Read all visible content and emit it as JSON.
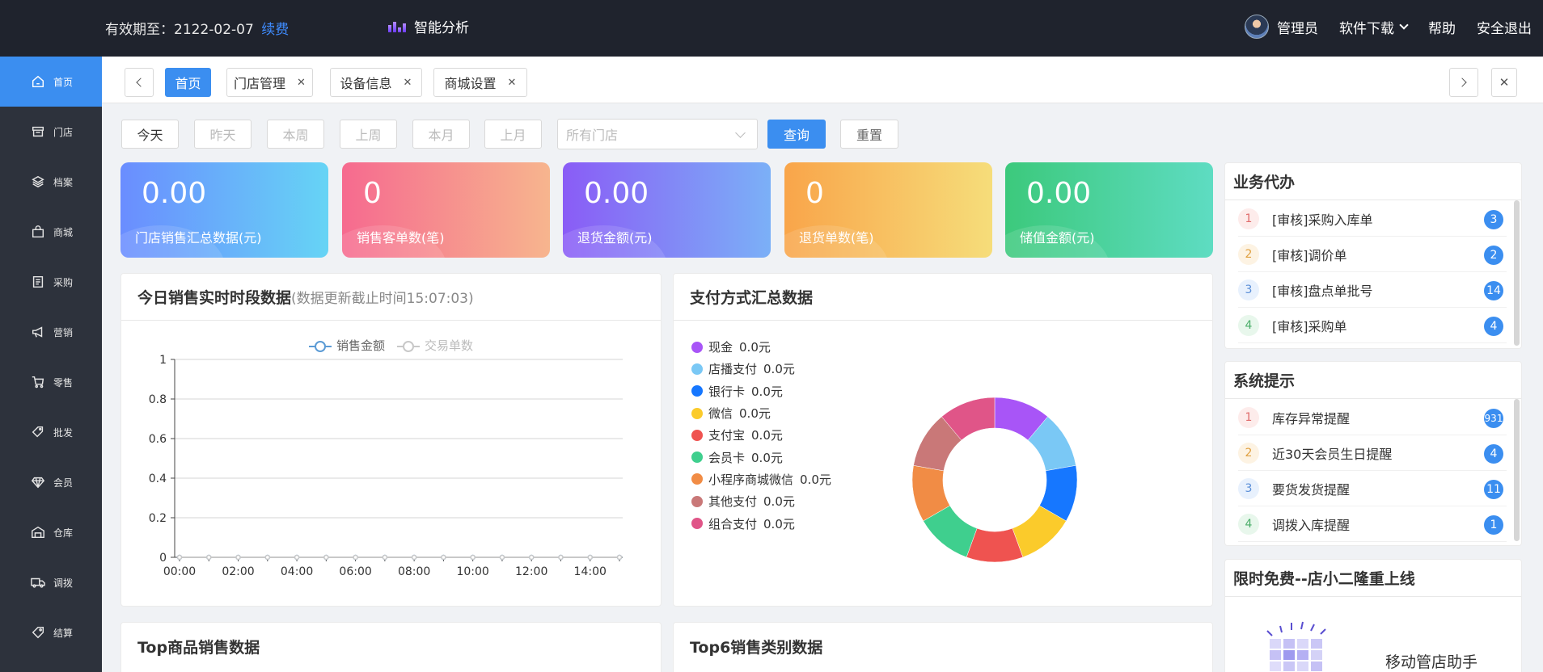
{
  "topbar": {
    "validity_label": "有效期至：2122-02-07",
    "renew": "续费",
    "brand": "智能分析",
    "user": "管理员",
    "download": "软件下载",
    "help": "帮助",
    "logout": "安全退出"
  },
  "sidebar": {
    "items": [
      {
        "label": "首页",
        "icon": "home-icon"
      },
      {
        "label": "门店",
        "icon": "store-icon"
      },
      {
        "label": "档案",
        "icon": "layers-icon"
      },
      {
        "label": "商城",
        "icon": "shopping-bag-icon"
      },
      {
        "label": "采购",
        "icon": "purchase-icon"
      },
      {
        "label": "营销",
        "icon": "megaphone-icon"
      },
      {
        "label": "零售",
        "icon": "cart-icon"
      },
      {
        "label": "批发",
        "icon": "wholesale-icon"
      },
      {
        "label": "会员",
        "icon": "diamond-icon"
      },
      {
        "label": "仓库",
        "icon": "warehouse-icon"
      },
      {
        "label": "调拨",
        "icon": "truck-icon"
      },
      {
        "label": "结算",
        "icon": "tag-icon"
      }
    ]
  },
  "tabs": [
    {
      "label": "首页"
    },
    {
      "label": "门店管理"
    },
    {
      "label": "设备信息"
    },
    {
      "label": "商城设置"
    }
  ],
  "filters": {
    "today": "今天",
    "yesterday": "昨天",
    "this_week": "本周",
    "last_week": "上周",
    "this_month": "本月",
    "last_month": "上月",
    "store_placeholder": "所有门店",
    "query": "查询",
    "reset": "重置"
  },
  "stats": [
    {
      "value": "0.00",
      "label": "门店销售汇总数据(元)",
      "colors": [
        "#6a8dff",
        "#66d4f5"
      ]
    },
    {
      "value": "0",
      "label": "销售客单数(笔)",
      "colors": [
        "#f66a8f",
        "#f7b58e"
      ]
    },
    {
      "value": "0.00",
      "label": "退货金额(元)",
      "colors": [
        "#8a5cf6",
        "#7bb0f7"
      ]
    },
    {
      "value": "0",
      "label": "退货单数(笔)",
      "colors": [
        "#f9a54a",
        "#f6dd7a"
      ]
    },
    {
      "value": "0.00",
      "label": "储值金额(元)",
      "colors": [
        "#3cc97c",
        "#5edcc2"
      ]
    }
  ],
  "realtime": {
    "title": "今日销售实时时段数据",
    "subtitle": "(数据更新截止时间15:07:03)"
  },
  "chart_data": [
    {
      "type": "line",
      "x": [
        "00:00",
        "01:00",
        "02:00",
        "03:00",
        "04:00",
        "05:00",
        "06:00",
        "07:00",
        "08:00",
        "09:00",
        "10:00",
        "11:00",
        "12:00",
        "13:00",
        "14:00",
        "15:00"
      ],
      "xticks": [
        "00:00",
        "02:00",
        "04:00",
        "06:00",
        "08:00",
        "10:00",
        "12:00",
        "14:00"
      ],
      "series": [
        {
          "name": "销售金额",
          "values": [
            0,
            0,
            0,
            0,
            0,
            0,
            0,
            0,
            0,
            0,
            0,
            0,
            0,
            0,
            0,
            0
          ],
          "color": "#5b9bd5"
        },
        {
          "name": "交易单数",
          "values": [
            0,
            0,
            0,
            0,
            0,
            0,
            0,
            0,
            0,
            0,
            0,
            0,
            0,
            0,
            0,
            0
          ],
          "color": "#c8c8c8"
        }
      ],
      "ylim": [
        0,
        1
      ],
      "yticks": [
        "0",
        "0.2",
        "0.4",
        "0.6",
        "0.8",
        "1"
      ],
      "grid": true,
      "legend": "top-center"
    },
    {
      "type": "pie",
      "title": "支付方式汇总数据",
      "categories": [
        "现金",
        "店播支付",
        "银行卡",
        "微信",
        "支付宝",
        "会员卡",
        "小程序商城微信",
        "其他支付",
        "组合支付"
      ],
      "values": [
        0.0,
        0.0,
        0.0,
        0.0,
        0.0,
        0.0,
        0.0,
        0.0,
        0.0
      ],
      "labels": [
        "0.0元",
        "0.0元",
        "0.0元",
        "0.0元",
        "0.0元",
        "0.0元",
        "0.0元",
        "0.0元",
        "0.0元"
      ],
      "colors": [
        "#a855f7",
        "#7ac8f5",
        "#1677ff",
        "#fbcb2b",
        "#ef5350",
        "#3fcf8e",
        "#f18c45",
        "#c97878",
        "#e05588"
      ],
      "donut": true,
      "legend": "left"
    }
  ],
  "pending": {
    "title": "业务代办",
    "items": [
      {
        "num": "1",
        "text": "[审核]采购入库单",
        "count": "3"
      },
      {
        "num": "2",
        "text": "[审核]调价单",
        "count": "2"
      },
      {
        "num": "3",
        "text": "[审核]盘点单批号",
        "count": "14"
      },
      {
        "num": "4",
        "text": "[审核]采购单",
        "count": "4"
      }
    ]
  },
  "notices": {
    "title": "系统提示",
    "items": [
      {
        "num": "1",
        "text": "库存异常提醒",
        "count": "931"
      },
      {
        "num": "2",
        "text": "近30天会员生日提醒",
        "count": "4"
      },
      {
        "num": "3",
        "text": "要货发货提醒",
        "count": "11"
      },
      {
        "num": "4",
        "text": "调拨入库提醒",
        "count": "1"
      }
    ]
  },
  "promo": {
    "title": "限时免费--店小二隆重上线",
    "caption": "移动管店助手"
  },
  "bottom": {
    "top_goods": "Top商品销售数据",
    "top6": "Top6销售类别数据"
  }
}
